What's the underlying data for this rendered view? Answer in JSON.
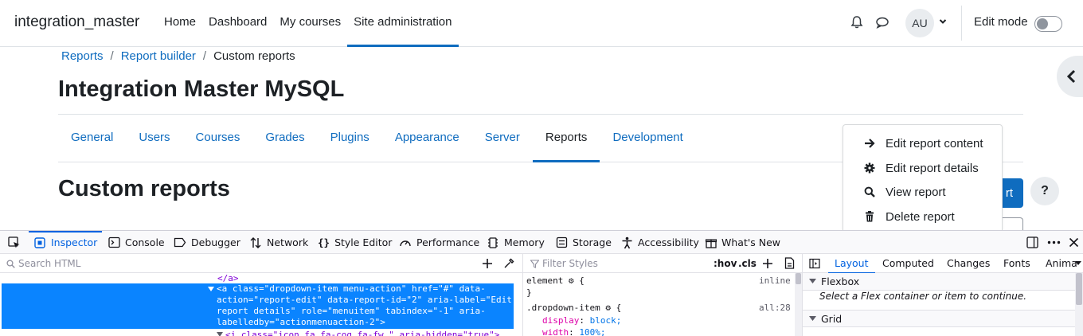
{
  "navbar": {
    "brand": "integration_master",
    "items": [
      "Home",
      "Dashboard",
      "My courses",
      "Site administration"
    ],
    "active_index": 3,
    "avatar_initials": "AU",
    "edit_mode_label": "Edit mode",
    "edit_mode_on": false
  },
  "breadcrumb": {
    "links": [
      "Reports",
      "Report builder"
    ],
    "separator": "/",
    "current": "Custom reports"
  },
  "page_title": "Integration Master MySQL",
  "secondary_nav": {
    "tabs": [
      "General",
      "Users",
      "Courses",
      "Grades",
      "Plugins",
      "Appearance",
      "Server",
      "Reports",
      "Development"
    ],
    "active_index": 7
  },
  "section_title": "Custom reports",
  "new_report_label_visible": "rt",
  "help_label": "?",
  "dropdown": {
    "items": [
      {
        "label": "Edit report content",
        "icon": "arrow-right-icon"
      },
      {
        "label": "Edit report details",
        "icon": "cog-icon"
      },
      {
        "label": "View report",
        "icon": "search-icon"
      },
      {
        "label": "Delete report",
        "icon": "trash-icon"
      }
    ]
  },
  "devtools": {
    "tabs": [
      "Inspector",
      "Console",
      "Debugger",
      "Network",
      "Style Editor",
      "Performance",
      "Memory",
      "Storage",
      "Accessibility",
      "What's New"
    ],
    "active_tab": "Inspector",
    "search_placeholder": "Search HTML",
    "filter_placeholder": "Filter Styles",
    "hov_label": ":hov",
    "cls_label": ".cls",
    "layout_tabs": [
      "Layout",
      "Computed",
      "Changes",
      "Fonts",
      "Anima"
    ],
    "active_layout_tab": "Layout",
    "markup": {
      "line0": "</a>",
      "sel_line1": "<a class=\"dropdown-item menu-action\" href=\"#\" data-",
      "sel_line2": "action=\"report-edit\" data-report-id=\"2\" aria-label=\"Edit",
      "sel_line3": "report details\" role=\"menuitem\" tabindex=\"-1\" aria-",
      "sel_line4": "labelledby=\"actionmenuaction-2\">",
      "line5": "<i class=\"icon fa fa-cog fa-fw \" aria-hidden=\"true\">"
    },
    "rules": {
      "element_selector": "element",
      "element_brace_open": "{",
      "element_brace_close": "}",
      "element_src": "inline",
      "rule_selector": ".dropdown-item",
      "rule_brace": "{",
      "rule_src": "all:28",
      "decl1_prop": "display",
      "decl1_val": "block;",
      "decl2_prop": "width",
      "decl2_val": "100%;"
    },
    "layout": {
      "flexbox_title": "Flexbox",
      "flexbox_msg": "Select a Flex container or item to continue.",
      "grid_title": "Grid"
    }
  }
}
